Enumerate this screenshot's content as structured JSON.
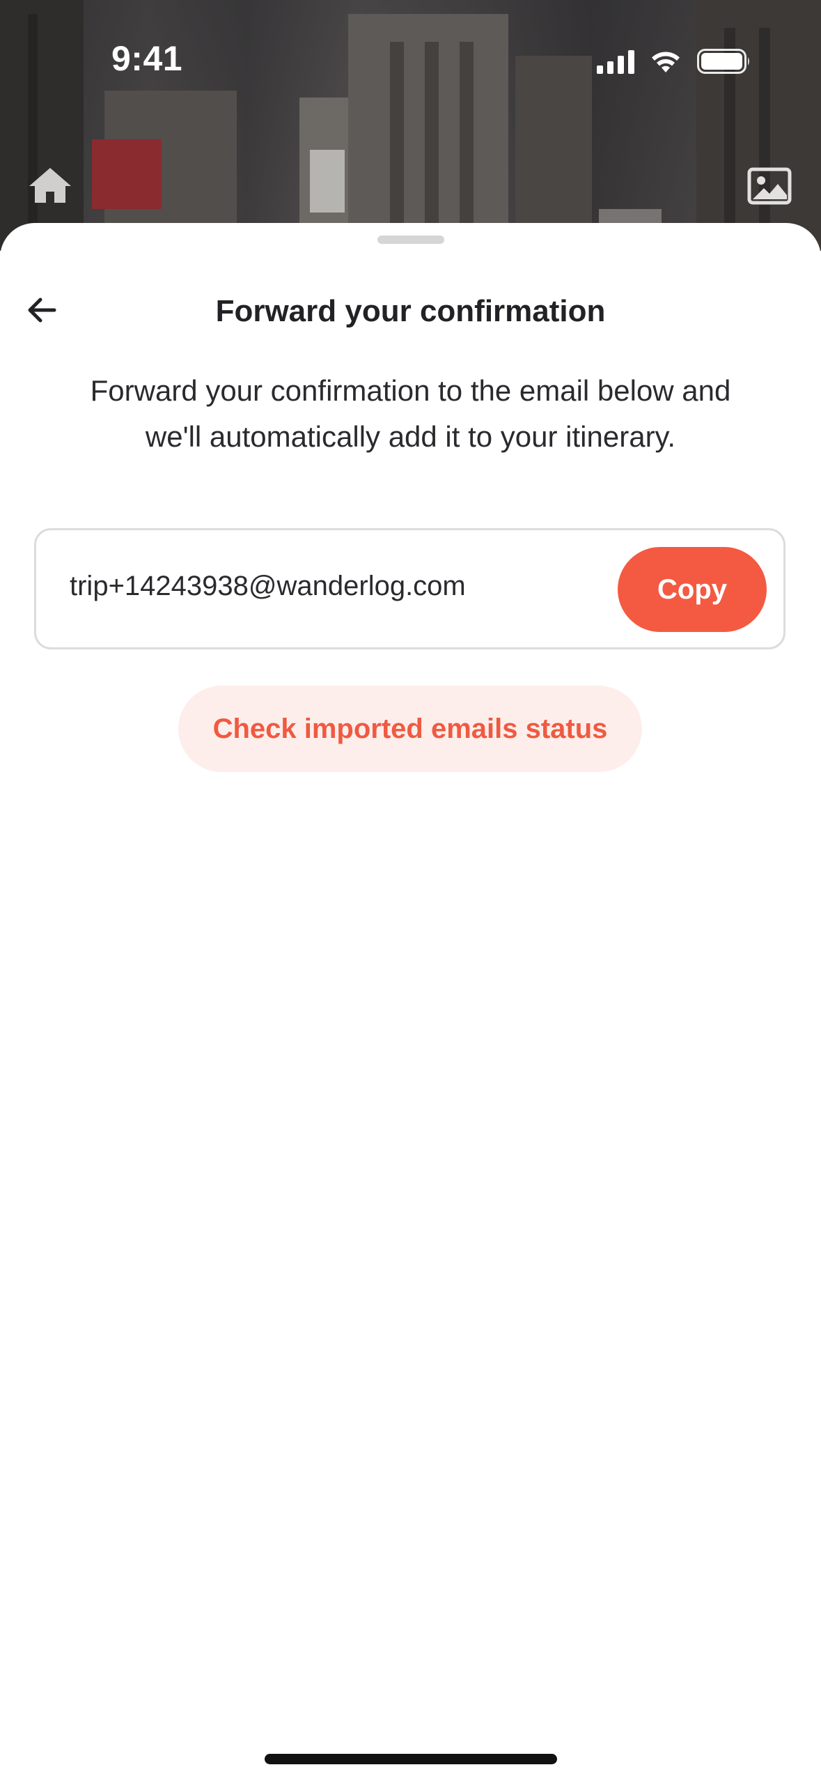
{
  "status_bar": {
    "time": "9:41"
  },
  "header": {
    "home_icon": "home-icon",
    "gallery_icon": "image-icon"
  },
  "sheet": {
    "title": "Forward your confirmation",
    "description": "Forward your confirmation to the email below and we'll automatically add it to your itinerary.",
    "email": "trip+14243938@wanderlog.com",
    "copy_label": "Copy",
    "status_label": "Check imported emails status",
    "back_icon": "arrow-left-icon"
  },
  "colors": {
    "accent": "#f45a42",
    "accent_soft": "#fdeeeb",
    "text": "#222226",
    "border": "#dcdcdf"
  }
}
